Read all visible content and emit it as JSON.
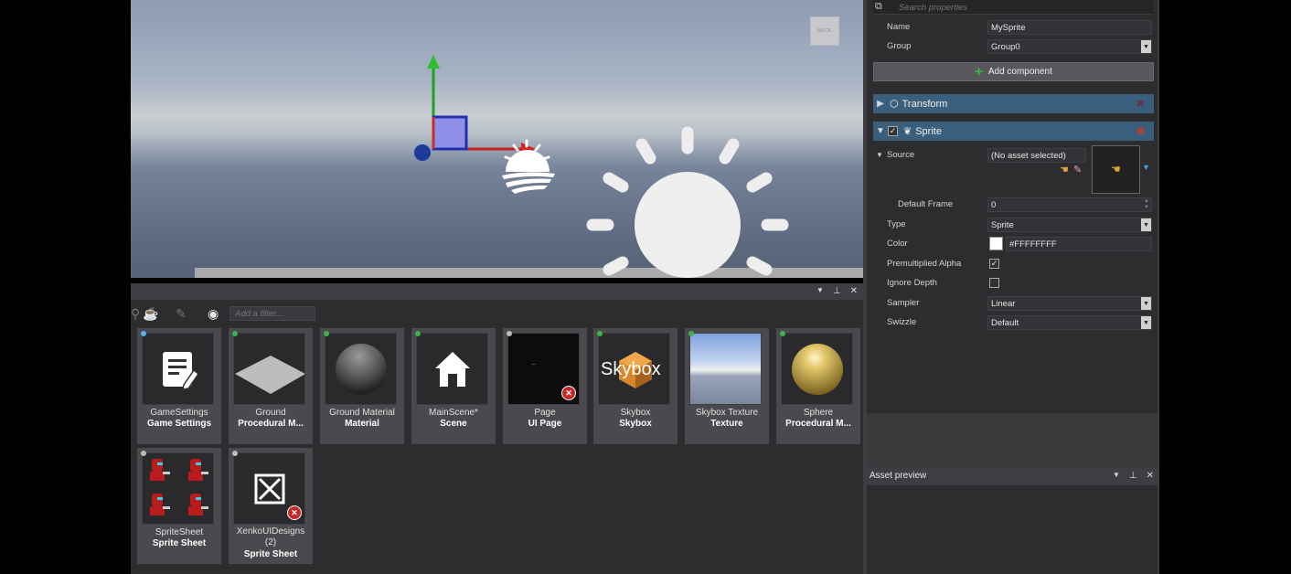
{
  "viewport": {
    "back_label": "BACK"
  },
  "properties": {
    "search_placeholder": "Search properties",
    "name_label": "Name",
    "name_value": "MySprite",
    "group_label": "Group",
    "group_value": "Group0",
    "add_component_label": "Add component",
    "transform_label": "Transform",
    "sprite_label": "Sprite",
    "source_label": "Source",
    "source_value": "(No asset selected)",
    "default_frame_label": "Default Frame",
    "default_frame_value": "0",
    "type_label": "Type",
    "type_value": "Sprite",
    "color_label": "Color",
    "color_value": "#FFFFFFFF",
    "premultiplied_label": "Premultiplied Alpha",
    "ignore_depth_label": "Ignore Depth",
    "sampler_label": "Sampler",
    "sampler_value": "Linear",
    "swizzle_label": "Swizzle",
    "swizzle_value": "Default"
  },
  "assets": {
    "filter_placeholder": "Add a filter...",
    "items": [
      {
        "name": "GameSettings",
        "type": "Game Settings"
      },
      {
        "name": "Ground",
        "type": "Procedural M..."
      },
      {
        "name": "Ground Material",
        "type": "Material"
      },
      {
        "name": "MainScene*",
        "type": "Scene"
      },
      {
        "name": "Page",
        "type": "UI Page"
      },
      {
        "name": "Skybox",
        "type": "Skybox",
        "thumb_text": "Skybox"
      },
      {
        "name": "Skybox Texture",
        "type": "Texture"
      },
      {
        "name": "Sphere",
        "type": "Procedural M..."
      },
      {
        "name": "SpriteSheet",
        "type": "Sprite Sheet"
      },
      {
        "name": "XenkoUIDesigns (2)",
        "type": "Sprite Sheet"
      }
    ]
  },
  "preview": {
    "title": "Asset preview"
  }
}
